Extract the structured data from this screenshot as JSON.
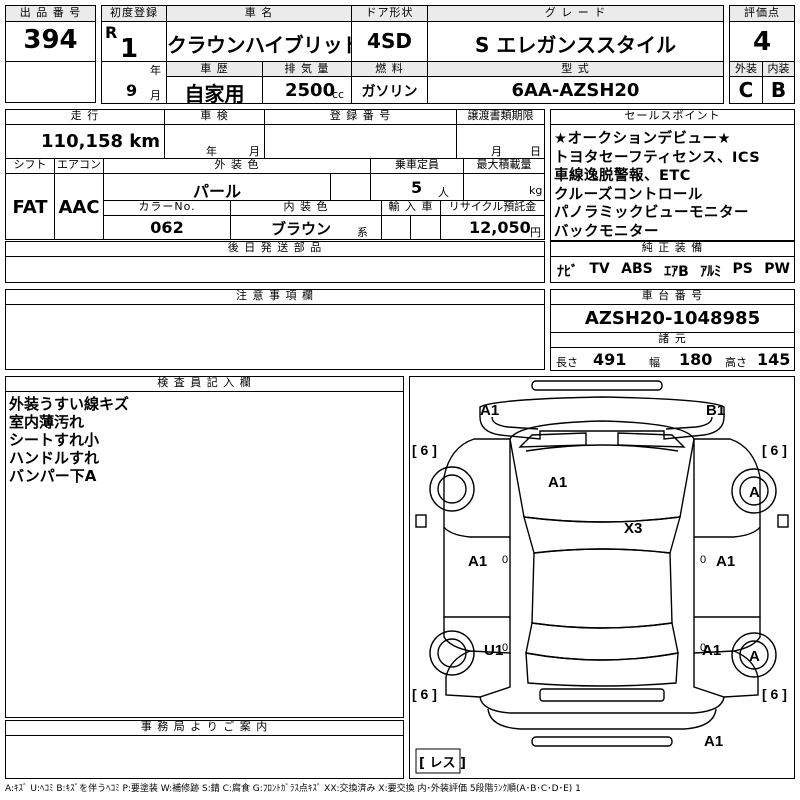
{
  "header": {
    "lot_label": "出 品 番 号",
    "lot_number": "394",
    "first_reg_label": "初度登録",
    "era": "R",
    "era_year": "1",
    "year_unit": "年",
    "month": "9",
    "month_unit": "月",
    "car_name_label": "車 名",
    "car_name": "クラウンハイブリッド",
    "door_label": "ドア形状",
    "door": "4SD",
    "grade_label": "グ レ ー ド",
    "grade": "S エレガンススタイル",
    "score_label": "評価点",
    "score": "4",
    "history_label": "車 歴",
    "history": "自家用",
    "displacement_label": "排 気 量",
    "displacement": "2500",
    "displacement_unit": "cc",
    "fuel_label": "燃 料",
    "fuel": "ガソリン",
    "model_label": "型 式",
    "model": "6AA-AZSH20",
    "exterior_label": "外装",
    "exterior_grade": "C",
    "interior_label": "内装",
    "interior_grade": "B"
  },
  "details": {
    "mileage_label": "走 行",
    "mileage": "110,158 km",
    "inspection_label": "車 検",
    "inspection_year_unit": "年",
    "inspection_month_unit": "月",
    "reg_no_label": "登 録 番 号",
    "transfer_label": "譲渡書類期限",
    "transfer_month_unit": "月",
    "transfer_day_unit": "日",
    "shift_label": "シフト",
    "shift": "FAT",
    "ac_label": "エアコン",
    "ac": "AAC",
    "color_label": "外 装 色",
    "color": "パール",
    "capacity_label": "乗車定員",
    "capacity": "5",
    "capacity_unit": "人",
    "maxload_label": "最大積載量",
    "maxload_unit": "kg",
    "color_no_label": "カラーNo.",
    "color_no": "062",
    "int_color_label": "内 装 色",
    "int_color": "ブラウン",
    "int_color_unit": "系",
    "import_label": "輸 入 車",
    "recycle_label": "リサイクル預託金",
    "recycle": "12,050",
    "recycle_unit": "円",
    "later_parts_label": "後 日 発 送 部 品",
    "notes_label": "注 意 事 項 欄",
    "inspector_label": "検 査 員 記 入 欄",
    "office_label": "事 務 局 よ り ご 案 内"
  },
  "inspector_notes": [
    "外装うすい線キズ",
    "室内薄汚れ",
    "シートすれ小",
    "ハンドルすれ",
    "バンパー下A"
  ],
  "sales_points_label": "セールスポイント",
  "sales_points": [
    "★オークションデビュー★",
    "トヨタセーフティセンス、ICS",
    "車線逸脱警報、ETC",
    "クルーズコントロール",
    "パノラミックビューモニター",
    "バックモニター"
  ],
  "equipment_label": "純 正 装 備",
  "equipment": [
    "ﾅﾋﾞ",
    "TV",
    "ABS",
    "ｴｱB",
    "ｱﾙﾐ",
    "PS",
    "PW"
  ],
  "chassis_label": "車 台 番 号",
  "chassis": "AZSH20-1048985",
  "specs_label": "諸 元",
  "specs": {
    "length_label": "長さ",
    "length": "491",
    "width_label": "幅",
    "width": "180",
    "height_label": "高さ",
    "height": "145"
  },
  "diagram": {
    "marks": {
      "front_left": "A1",
      "front_right": "B1",
      "hood": "A1",
      "roof": "X3",
      "left_front_door": "A1",
      "right_front_door": "A1",
      "left_rear": "U1",
      "right_rear": "A1",
      "rear_bumper": "A1",
      "wheel_front_right": "A",
      "wheel_rear_right": "A"
    },
    "tires": {
      "front_left": "[ 6 ]",
      "front_right": "[ 6 ]",
      "rear_left": "[ 6 ]",
      "rear_right": "[ 6 ]",
      "spare": "[ レス ]"
    },
    "zeros": [
      "0",
      "0",
      "0",
      "0"
    ]
  },
  "legend": "A:ｷｽﾞ U:ﾍｺﾐ B:ｷｽﾞを伴うﾍｺﾐ P:要塗装 W:補修跡 S:錆 C:腐食 G:ﾌﾛﾝﾄｶﾞﾗｽ点ｷｽﾞ XX:交換済み X:要交換 内･外装評価 5段階ﾗﾝｸ順(A･B･C･D･E) 1"
}
